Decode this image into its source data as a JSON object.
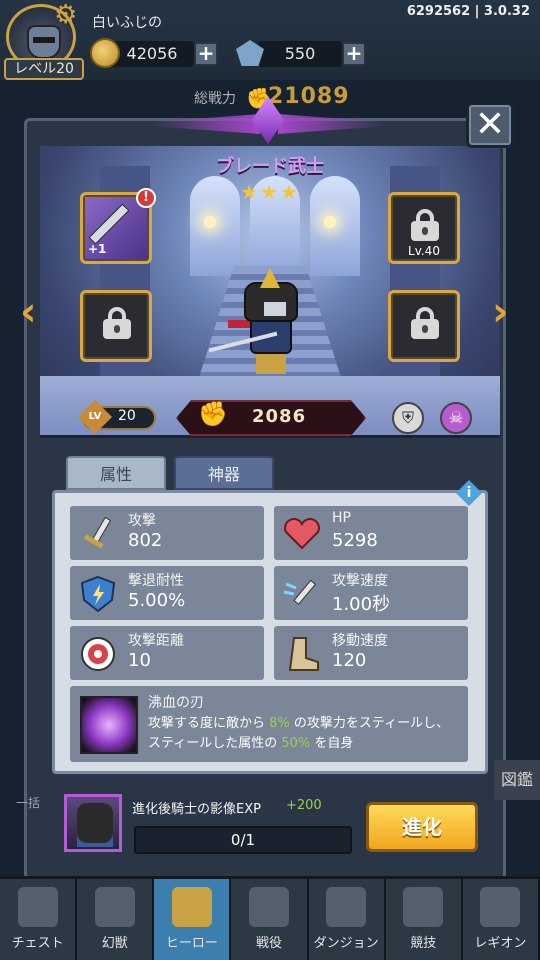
{
  "topbar": {
    "player_name": "白いふじの",
    "level_label": "レベル20",
    "version": "6292562 | 3.0.32",
    "gold": "42056",
    "gems": "550",
    "plus": "+"
  },
  "power": {
    "label": "総戦力",
    "value": "21089"
  },
  "close_label": "✕",
  "hero": {
    "name": "ブレード武士",
    "stars": "★★★",
    "level_prefix": "LV",
    "level": "20",
    "combat_power": "2086"
  },
  "slots": {
    "weapon_level": "+1",
    "weapon_alert": "!",
    "locked_slot_level": "Lv.40"
  },
  "tabs": {
    "attributes": "属性",
    "artifact": "神器"
  },
  "info_icon": "i",
  "stats": {
    "attack": {
      "label": "攻撃",
      "value": "802"
    },
    "hp": {
      "label": "HP",
      "value": "5298"
    },
    "knockback_resist": {
      "label": "撃退耐性",
      "value": "5.00%"
    },
    "attack_speed": {
      "label": "攻撃速度",
      "value": "1.00秒"
    },
    "attack_range": {
      "label": "攻撃距離",
      "value": "10"
    },
    "move_speed": {
      "label": "移動速度",
      "value": "120"
    }
  },
  "skill": {
    "name": "沸血の刃",
    "desc_1": "攻撃する度に敵から",
    "pct_1": "8%",
    "desc_2": "の攻撃力をスティールし、スティールした属性の",
    "pct_2": "50%",
    "desc_3": "を自身"
  },
  "evolve": {
    "text": "進化後騎士の影像EXP",
    "bonus": "+200",
    "progress": "0/1",
    "button": "進化"
  },
  "side": {
    "left": "一括",
    "right": "図鑑"
  },
  "nav": [
    {
      "label": "チェスト"
    },
    {
      "label": "幻獣"
    },
    {
      "label": "ヒーロー"
    },
    {
      "label": "戦役"
    },
    {
      "label": "ダンジョン"
    },
    {
      "label": "競技"
    },
    {
      "label": "レギオン"
    }
  ],
  "colors": {
    "accent_gold": "#c9a244",
    "accent_purple": "#a448c9",
    "highlight_green": "#97d24b"
  },
  "icons": {
    "gear": "gear-icon",
    "gold": "coin-icon",
    "gem": "gem-icon",
    "fist": "fist-icon",
    "lock": "lock-icon",
    "sword": "sword-icon",
    "heart": "heart-icon",
    "shield": "shield-icon",
    "target": "target-icon",
    "boot": "boot-icon",
    "skull": "skull-icon"
  }
}
